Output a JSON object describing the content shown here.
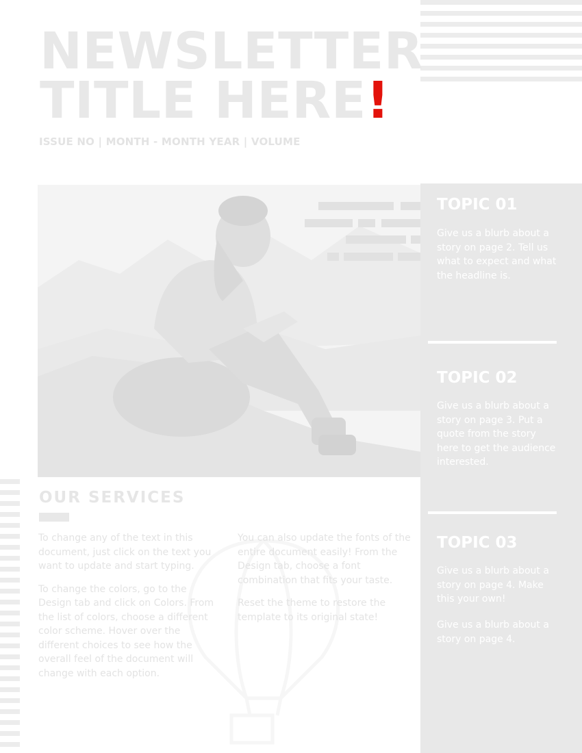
{
  "header": {
    "title_line1": "NEWSLETTER",
    "title_line2": "TITLE HERE",
    "title_exclamation": "!",
    "issue_line": "ISSUE NO  |  MONTH - MONTH YEAR  |  VOLUME"
  },
  "sidebar": {
    "topics": [
      {
        "title": "TOPIC 01",
        "body": "Give us a blurb about a story on page 2.  Tell us what to expect and what the headline is."
      },
      {
        "title": "TOPIC 02",
        "body": "Give us a blurb about a story on page 3.  Put a quote from the story here to get the audience interested."
      },
      {
        "title": "TOPIC 03",
        "body": "Give us a blurb about a story on page 4. Make this your own!",
        "body2": "Give us a blurb about a story on page 4."
      }
    ]
  },
  "services": {
    "heading": "OUR SERVICES",
    "column1": [
      "To change any of the text in this document, just click on the text you want to update and start typing.",
      "To change the colors, go to the Design tab and click on Colors. From the list of colors, choose a different color scheme.  Hover over the different choices to see how the overall feel of the document will change with each option."
    ],
    "column2": [
      "You can also update the fonts of the entire document easily!  From the Design tab, choose a font combination that fits your taste.",
      "Reset the theme to restore the template to its original state!"
    ]
  },
  "colors": {
    "accent": "#e3120b",
    "title_text": "#e8e8e8",
    "sidebar_bg": "#e8e8e8",
    "body_text": "#e3e3e3"
  },
  "icons": [
    "hot-air-balloon-icon"
  ]
}
